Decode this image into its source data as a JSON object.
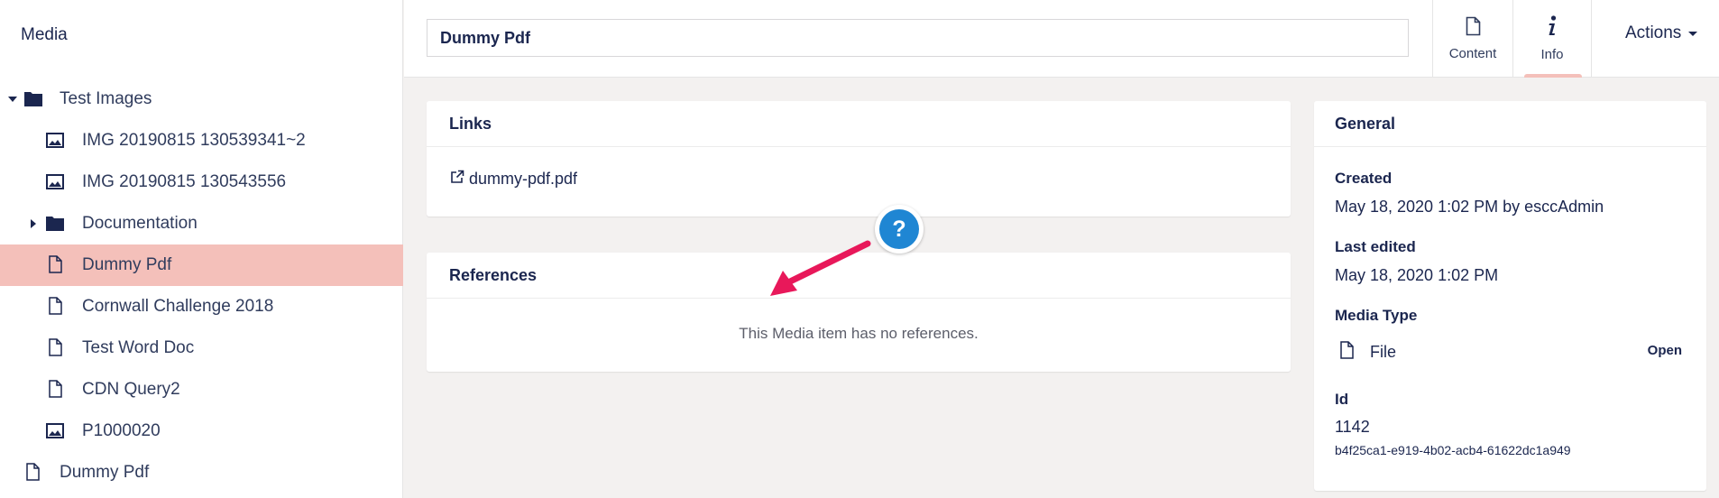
{
  "sidebar": {
    "title": "Media",
    "items": [
      {
        "label": "Test Images",
        "icon": "folder-icon",
        "caret": "down"
      },
      {
        "label": "IMG 20190815 130539341~2",
        "icon": "image-icon"
      },
      {
        "label": "IMG 20190815 130543556",
        "icon": "image-icon"
      },
      {
        "label": "Documentation",
        "icon": "folder-icon",
        "caret": "right"
      },
      {
        "label": "Dummy Pdf",
        "icon": "file-icon",
        "selected": true
      },
      {
        "label": "Cornwall Challenge 2018",
        "icon": "file-icon"
      },
      {
        "label": "Test Word Doc",
        "icon": "file-icon"
      },
      {
        "label": "CDN Query2",
        "icon": "file-icon"
      },
      {
        "label": "P1000020",
        "icon": "image-icon"
      },
      {
        "label": "Dummy Pdf",
        "icon": "file-icon"
      }
    ]
  },
  "header": {
    "name_value": "Dummy Pdf",
    "tabs": [
      {
        "label": "Content",
        "icon": "document-icon"
      },
      {
        "label": "Info",
        "icon": "info-icon",
        "active": true
      }
    ],
    "actions_label": "Actions"
  },
  "links": {
    "title": "Links",
    "file_link": "dummy-pdf.pdf"
  },
  "references": {
    "title": "References",
    "empty_message": "This Media item has no references."
  },
  "general": {
    "title": "General",
    "created_label": "Created",
    "created_value": "May 18, 2020 1:02 PM by esccAdmin",
    "edited_label": "Last edited",
    "edited_value": "May 18, 2020 1:02 PM",
    "media_type_label": "Media Type",
    "media_type_value": "File",
    "open_label": "Open",
    "id_label": "Id",
    "id_value": "1142",
    "guid_value": "b4f25ca1-e919-4b02-acb4-61622dc1a949"
  },
  "annotation": {
    "help_glyph": "?",
    "help_color": "#1f86d3",
    "arrow_color": "#e8185a"
  },
  "colors": {
    "selected_row": "#f4c0ba",
    "text_primary": "#1b264f",
    "background": "#f3f1f0"
  }
}
